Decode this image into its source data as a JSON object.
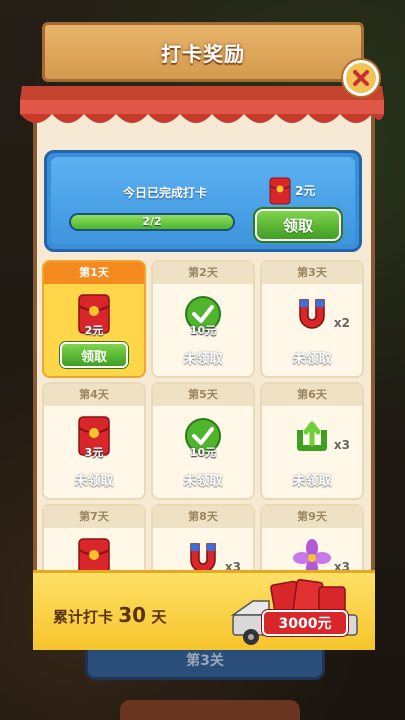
{
  "header": {
    "title": "打卡奖励"
  },
  "today": {
    "done_label": "今日已完成打卡",
    "progress_text": "2/2",
    "progress_fraction": 1.0,
    "reward_amount": "2元",
    "claim_label": "领取"
  },
  "days": [
    {
      "label": "第1天",
      "reward": "redpacket",
      "amount": "2元",
      "status": "领取",
      "active": true
    },
    {
      "label": "第2天",
      "reward": "check",
      "amount": "10元",
      "status": "未领取"
    },
    {
      "label": "第3天",
      "reward": "magnet",
      "mult": "x2",
      "status": "未领取"
    },
    {
      "label": "第4天",
      "reward": "redpacket",
      "amount": "3元",
      "status": "未领取"
    },
    {
      "label": "第5天",
      "reward": "check",
      "amount": "10元",
      "status": "未领取"
    },
    {
      "label": "第6天",
      "reward": "recycle",
      "mult": "x3",
      "status": "未领取"
    },
    {
      "label": "第7天",
      "reward": "redpacket",
      "status": ""
    },
    {
      "label": "第8天",
      "reward": "magnet",
      "mult": "x3",
      "status": ""
    },
    {
      "label": "第9天",
      "reward": "fan",
      "mult": "x3",
      "status": ""
    }
  ],
  "cumulative": {
    "prefix": "累计打卡",
    "days": "30",
    "suffix": "天",
    "reward": "3000元"
  },
  "background": {
    "button_text": "第3关"
  },
  "colors": {
    "accent_green": "#4fb52c",
    "blue_card": "#3b8fd9",
    "banner_yellow": "#f6c52c",
    "red_packet": "#d8262a"
  }
}
